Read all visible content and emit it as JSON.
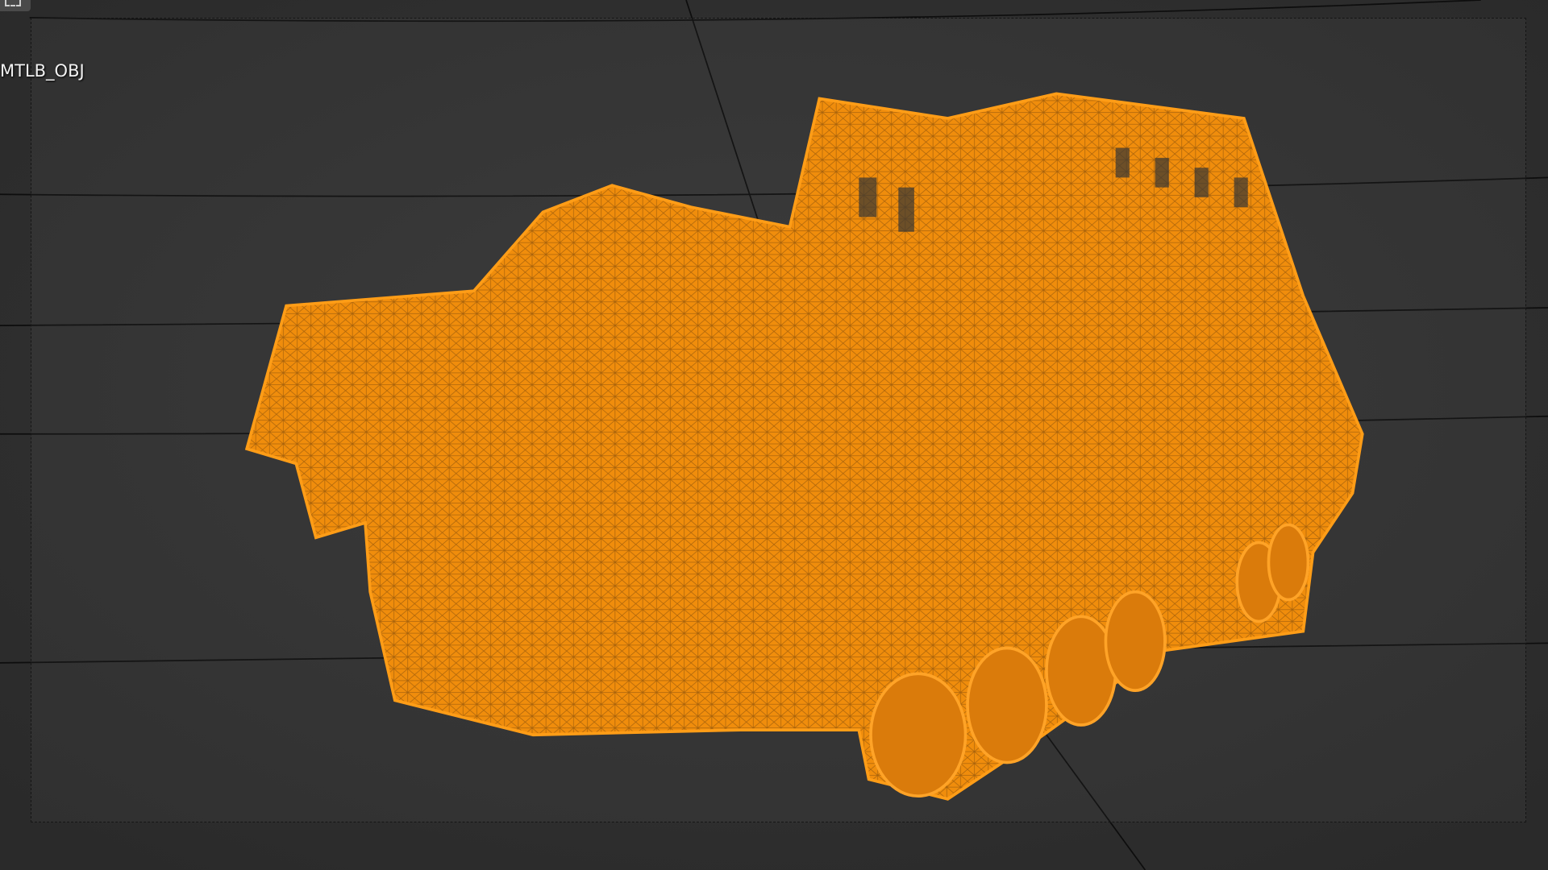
{
  "viewport": {
    "object_label": "MTLB_OBJ",
    "wireframe_color": "#ff8c00",
    "background_color": "#2a2a2a"
  }
}
